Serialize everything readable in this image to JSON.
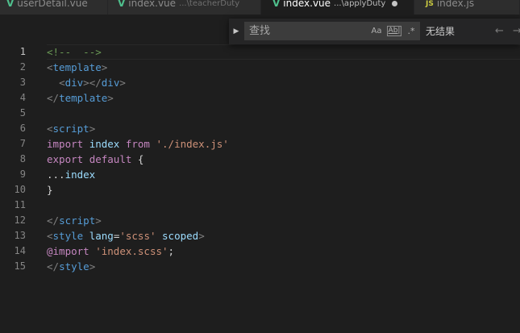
{
  "tabs": [
    {
      "name": "userDetail.vue",
      "desc": "",
      "icon": "vue-icon",
      "active": false
    },
    {
      "name": "index.vue",
      "desc": "...\\teacherDuty",
      "icon": "vue-icon",
      "active": false
    },
    {
      "name": "index.vue",
      "desc": "...\\applyDuty",
      "icon": "vue-icon",
      "active": true,
      "dirty": true
    },
    {
      "name": "index.js",
      "desc": "",
      "icon": "js-icon",
      "active": false
    }
  ],
  "find": {
    "placeholder": "查找",
    "match_case": "Aa",
    "whole_word": "Ab|",
    "regex": ".*",
    "result": "无结果",
    "prev": "←",
    "next": "→"
  },
  "editor": {
    "line_numbers": [
      "1",
      "2",
      "3",
      "4",
      "5",
      "6",
      "7",
      "8",
      "9",
      "10",
      "11",
      "12",
      "13",
      "14",
      "15"
    ],
    "l1": {
      "open": "<!--",
      "close": "-->"
    },
    "l2": {
      "open": "<",
      "tag": "template",
      "close": ">"
    },
    "l3": {
      "indent": "  ",
      "o1": "<",
      "tag1": "div",
      "c1": ">",
      "o2": "</",
      "tag2": "div",
      "c2": ">"
    },
    "l4": {
      "open": "</",
      "tag": "template",
      "close": ">"
    },
    "l6": {
      "open": "<",
      "tag": "script",
      "close": ">"
    },
    "l7": {
      "kw1": "import",
      "id": "index",
      "kw2": "from",
      "str": "'./index.js'"
    },
    "l8": {
      "kw1": "export",
      "kw2": "default",
      "brace": "{"
    },
    "l9": {
      "spread": "...",
      "id": "index"
    },
    "l10": {
      "brace": "}"
    },
    "l12": {
      "open": "</",
      "tag": "script",
      "close": ">"
    },
    "l13": {
      "open": "<",
      "tag": "style",
      "attr1": "lang",
      "eq": "=",
      "val": "'scss'",
      "attr2": "scoped",
      "close": ">"
    },
    "l14": {
      "kw": "@import",
      "str": "'index.scss'",
      "semi": ";"
    },
    "l15": {
      "open": "</",
      "tag": "style",
      "close": ">"
    }
  }
}
